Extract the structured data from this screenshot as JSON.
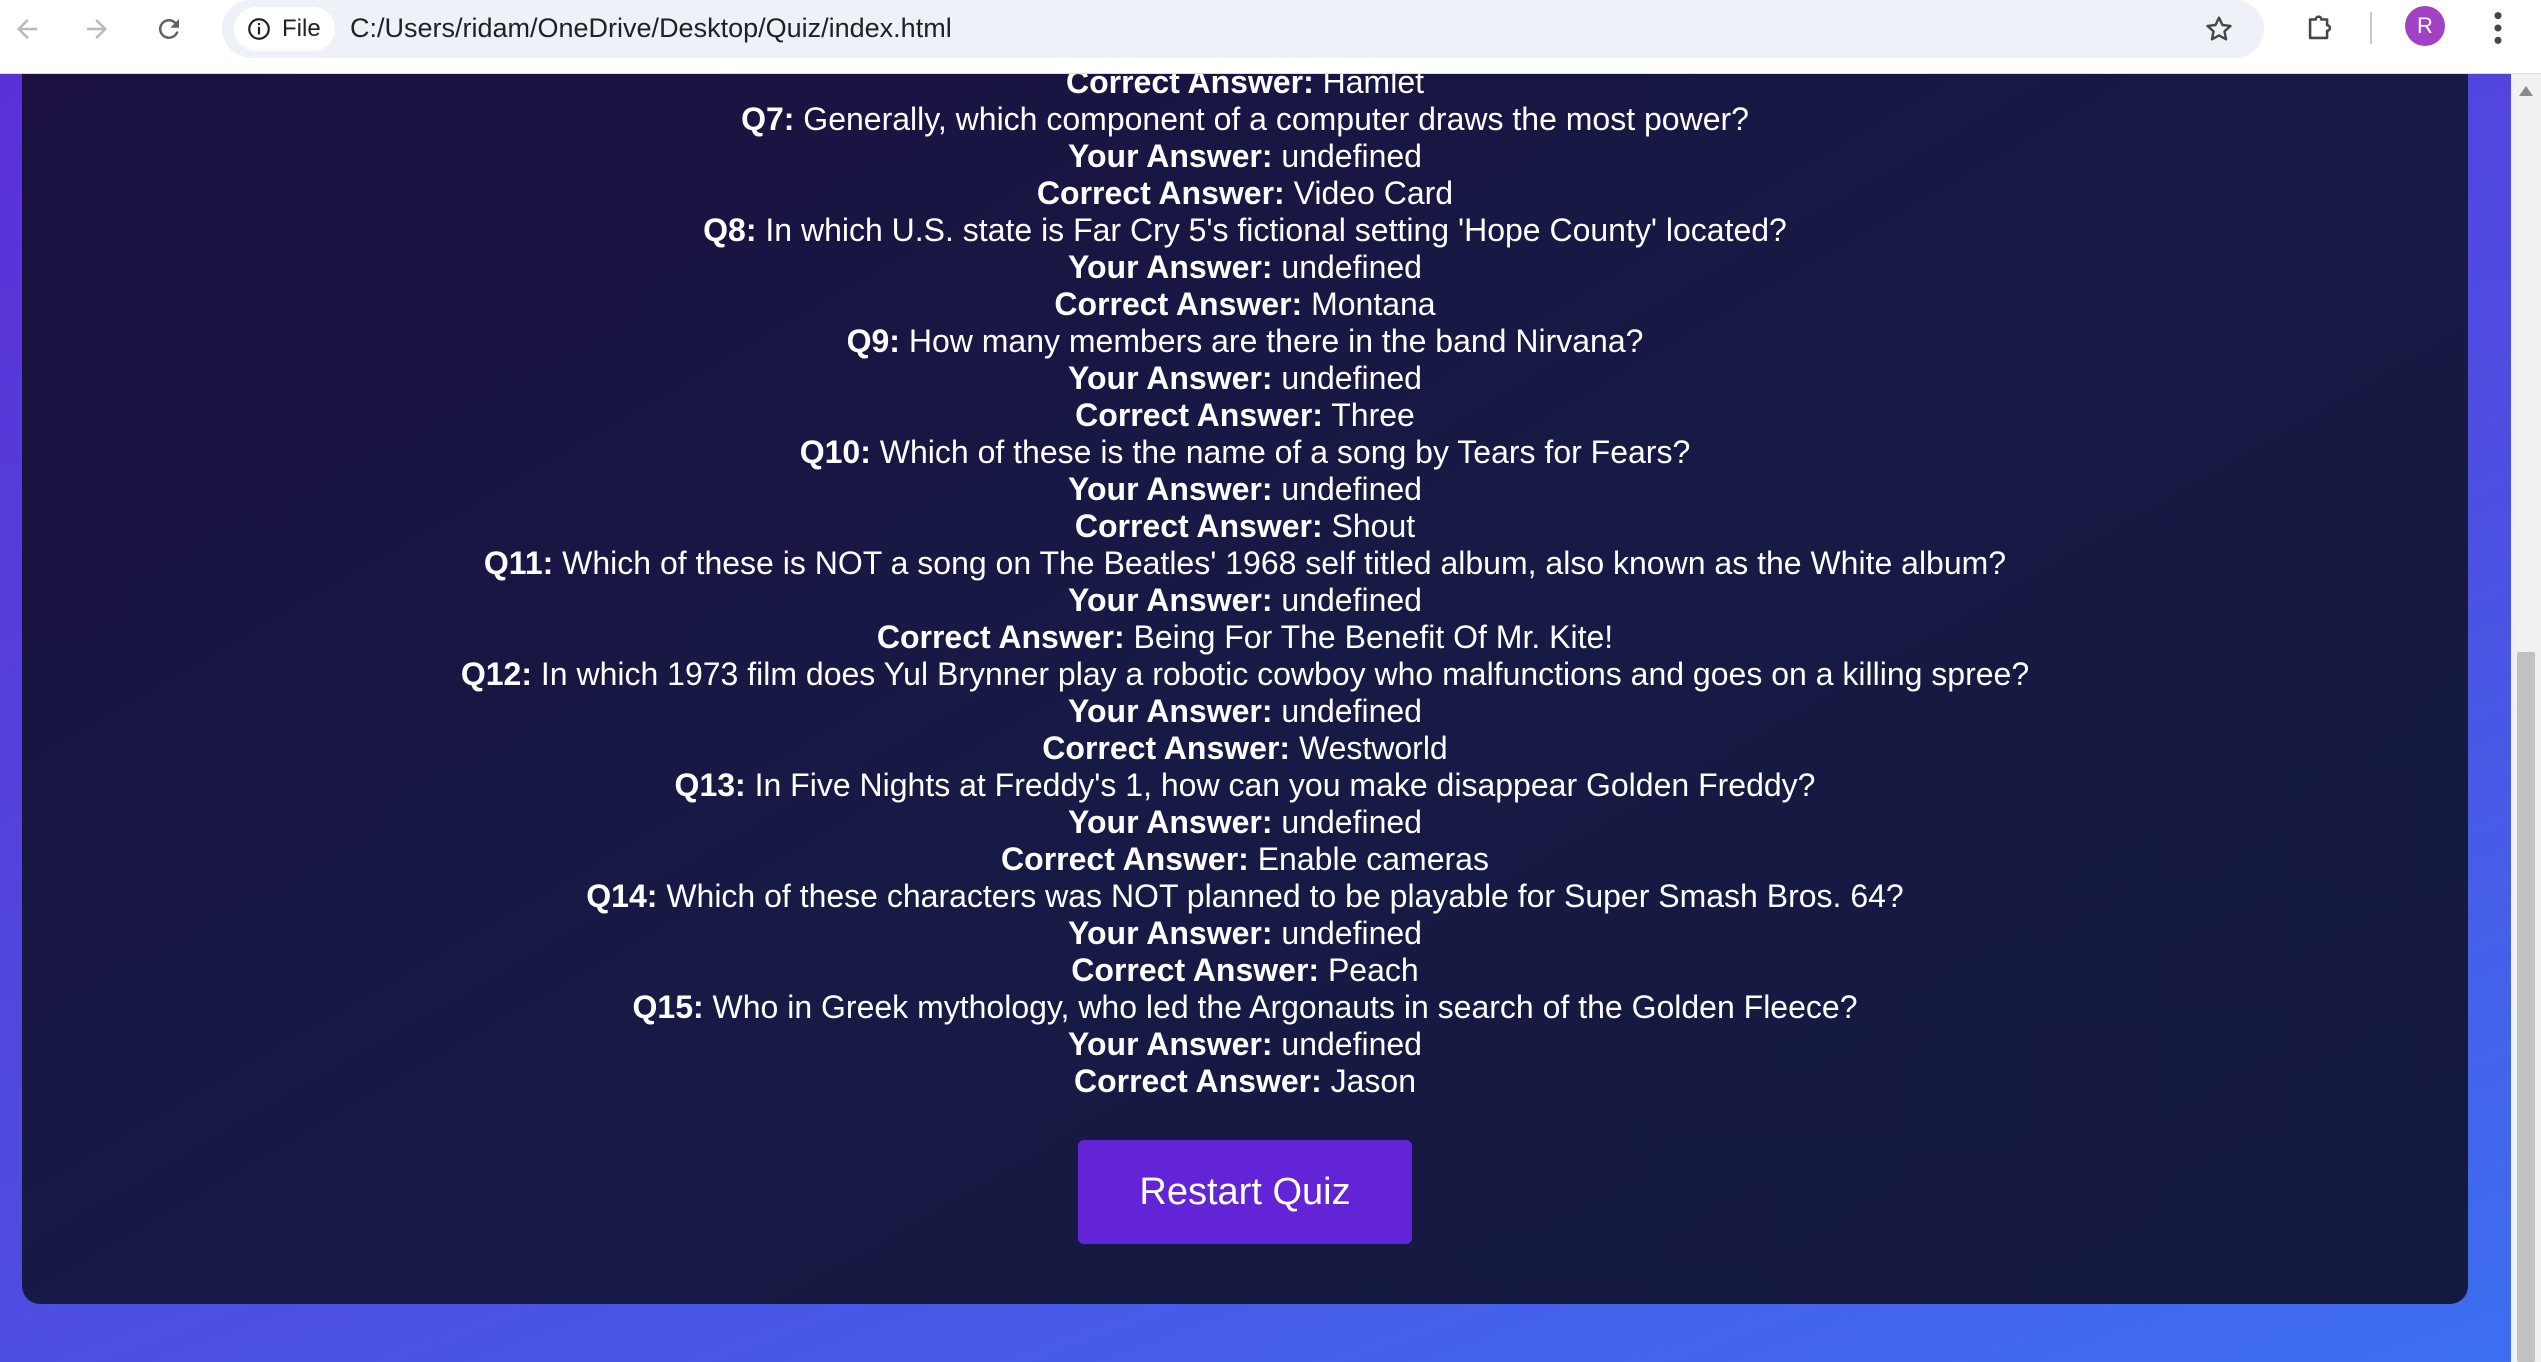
{
  "browser": {
    "site_chip_label": "File",
    "url": "C:/Users/ridam/OneDrive/Desktop/Quiz/index.html",
    "avatar_initial": "R"
  },
  "labels": {
    "your_answer": "Your Answer:",
    "correct_answer": "Correct Answer:"
  },
  "top_partial": {
    "label": "Correct Answer:",
    "value": "Hamlet"
  },
  "questions": [
    {
      "num": "Q7:",
      "text": "Generally, which component of a computer draws the most power?",
      "your_answer": "undefined",
      "correct_answer": "Video Card"
    },
    {
      "num": "Q8:",
      "text": "In which U.S. state is Far Cry 5's fictional setting 'Hope County' located?",
      "your_answer": "undefined",
      "correct_answer": "Montana"
    },
    {
      "num": "Q9:",
      "text": "How many members are there in the band Nirvana?",
      "your_answer": "undefined",
      "correct_answer": "Three"
    },
    {
      "num": "Q10:",
      "text": "Which of these is the name of a song by Tears for Fears?",
      "your_answer": "undefined",
      "correct_answer": "Shout"
    },
    {
      "num": "Q11:",
      "text": "Which of these is NOT a song on The Beatles' 1968 self titled album, also known as the White album?",
      "your_answer": "undefined",
      "correct_answer": "Being For The Benefit Of Mr. Kite!"
    },
    {
      "num": "Q12:",
      "text": "In which 1973 film does Yul Brynner play a robotic cowboy who malfunctions and goes on a killing spree?",
      "your_answer": "undefined",
      "correct_answer": "Westworld"
    },
    {
      "num": "Q13:",
      "text": "In Five Nights at Freddy's 1, how can you make disappear Golden Freddy?",
      "your_answer": "undefined",
      "correct_answer": "Enable cameras"
    },
    {
      "num": "Q14:",
      "text": "Which of these characters was NOT planned to be playable for Super Smash Bros. 64?",
      "your_answer": "undefined",
      "correct_answer": "Peach"
    },
    {
      "num": "Q15:",
      "text": "Who in Greek mythology, who led the Argonauts in search of the Golden Fleece?",
      "your_answer": "undefined",
      "correct_answer": "Jason"
    }
  ],
  "restart_label": "Restart Quiz",
  "colors": {
    "card_bg": "#171a45",
    "button_bg": "#6323d6",
    "page_gradient_start": "#5b2fd6",
    "page_gradient_end": "#3d6ff0"
  },
  "icons": [
    "back-icon",
    "forward-icon",
    "reload-icon",
    "info-icon",
    "star-icon",
    "extensions-icon",
    "more-menu-icon"
  ]
}
